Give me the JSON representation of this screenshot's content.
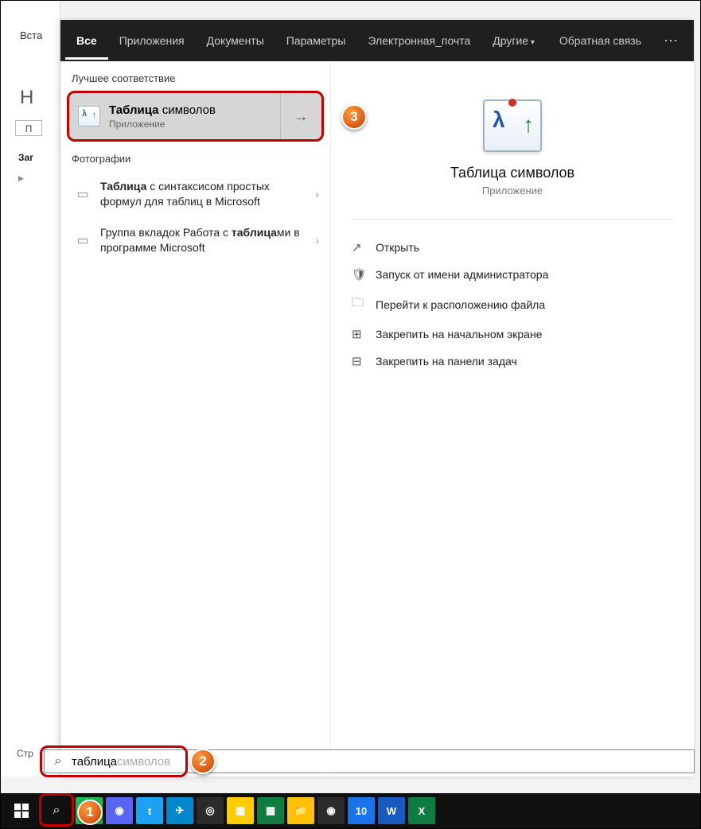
{
  "bg": {
    "vsta": "Вста",
    "h": "Н",
    "p": "П",
    "zag": "Заг",
    "str": "Стр"
  },
  "tabs": {
    "items": [
      "Все",
      "Приложения",
      "Документы",
      "Параметры",
      "Электронная_почта",
      "Другие"
    ],
    "feedback": "Обратная связь",
    "more": "⋯"
  },
  "left": {
    "best_hdr": "Лучшее соответствие",
    "best": {
      "title_bold": "Таблица",
      "title_rest": " символов",
      "sub": "Приложение"
    },
    "photos_hdr": "Фотографии",
    "r1": {
      "bold": "Таблица",
      "rest": " с синтаксисом простых формул для таблиц в Microsoft"
    },
    "r2": {
      "pre": "Группа вкладок Работа с ",
      "bold": "таблица",
      "post": "ми в программе Microsoft"
    }
  },
  "right": {
    "title": "Таблица символов",
    "sub": "Приложение",
    "actions": [
      "Открыть",
      "Запуск от имени администратора",
      "Перейти к расположению файла",
      "Закрепить на начальном экране",
      "Закрепить на панели задач"
    ]
  },
  "search": {
    "typed": "таблица",
    "suggest": " символов"
  },
  "anno": {
    "a1": "1",
    "a2": "2",
    "a3": "3"
  },
  "taskbar_apps": [
    {
      "bg": "#1db954",
      "t": "●"
    },
    {
      "bg": "#5865f2",
      "t": "◉"
    },
    {
      "bg": "#1da1f2",
      "t": "t"
    },
    {
      "bg": "#0088cc",
      "t": "✈"
    },
    {
      "bg": "#2b2b2b",
      "t": "◎"
    },
    {
      "bg": "#ffcc00",
      "t": "▦"
    },
    {
      "bg": "#107c41",
      "t": "▦"
    },
    {
      "bg": "#ffc107",
      "t": "📁"
    },
    {
      "bg": "#2b2b2b",
      "t": "◉"
    },
    {
      "bg": "#1a73e8",
      "t": "10"
    },
    {
      "bg": "#185abd",
      "t": "W"
    },
    {
      "bg": "#107c41",
      "t": "X"
    }
  ]
}
